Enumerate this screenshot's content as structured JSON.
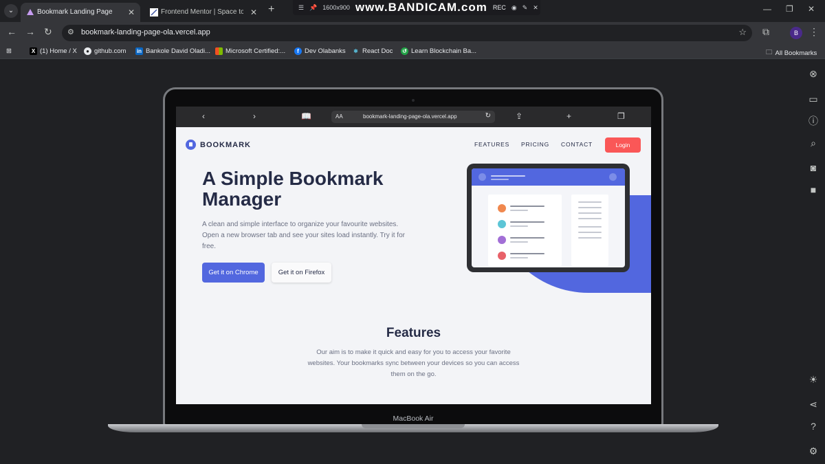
{
  "browser": {
    "tabs": [
      {
        "title": "Bookmark Landing Page",
        "active": true
      },
      {
        "title": "Frontend Mentor | Space tourism",
        "active": false
      }
    ],
    "url": "bookmark-landing-page-ola.vercel.app",
    "profile_initial": "B",
    "bookmarks": [
      "(1) Home / X",
      "github.com",
      "Bankole David Oladi...",
      "Microsoft Certified:...",
      "Dev Olabanks",
      "React Doc",
      "Learn Blockchain Ba..."
    ],
    "all_bookmarks": "All Bookmarks"
  },
  "recorder": {
    "resolution": "1600x900",
    "brand": "www.BANDICAM.com",
    "rec": "REC"
  },
  "device": {
    "label": "MacBook Air",
    "inner_url": "bookmark-landing-page-ola.vercel.app",
    "inner_aa": "AA"
  },
  "site": {
    "logo": "BOOKMARK",
    "nav": [
      "FEATURES",
      "PRICING",
      "CONTACT"
    ],
    "login": "Login",
    "hero_title": "A Simple Bookmark Manager",
    "hero_text": "A clean and simple interface to organize your favourite websites. Open a new browser tab and see your sites load instantly. Try it for free.",
    "cta_chrome": "Get it on Chrome",
    "cta_firefox": "Get it on Firefox",
    "features_title": "Features",
    "features_text": "Our aim is to make it quick and easy for you to access your favorite websites. Your bookmarks sync between your devices so you can access them on the go."
  },
  "colors": {
    "accent_blue": "#5267df",
    "accent_red": "#fa5757",
    "dark_text": "#252b46",
    "dots": [
      "#f0884e",
      "#5cc5d6",
      "#a26fd6",
      "#e86169"
    ]
  }
}
